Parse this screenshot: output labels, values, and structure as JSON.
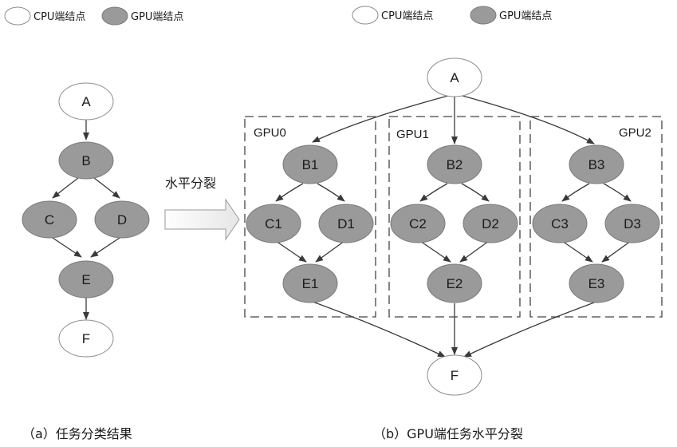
{
  "legend": {
    "cpu_label": "CPU端结点",
    "gpu_label": "GPU端结点",
    "cpu_fill": "#ffffff",
    "gpu_fill": "#9a9a9a"
  },
  "colors": {
    "stroke": "#8c8c8c",
    "edge": "#3a3a3a",
    "box": "#444444",
    "arrow_fill": "#f3f3f3"
  },
  "left_graph": {
    "nodes": {
      "A": "A",
      "B": "B",
      "C": "C",
      "D": "D",
      "E": "E",
      "F": "F"
    },
    "caption": "（a）任务分类结果"
  },
  "split_label": "水平分裂",
  "right_graph": {
    "gpu_boxes": [
      "GPU0",
      "GPU1",
      "GPU2"
    ],
    "nodes": {
      "A": "A",
      "F": "F",
      "B1": "B1",
      "C1": "C1",
      "D1": "D1",
      "E1": "E1",
      "B2": "B2",
      "C2": "C2",
      "D2": "D2",
      "E2": "E2",
      "B3": "B3",
      "C3": "C3",
      "D3": "D3",
      "E3": "E3"
    },
    "caption": "（b）GPU端任务水平分裂"
  }
}
